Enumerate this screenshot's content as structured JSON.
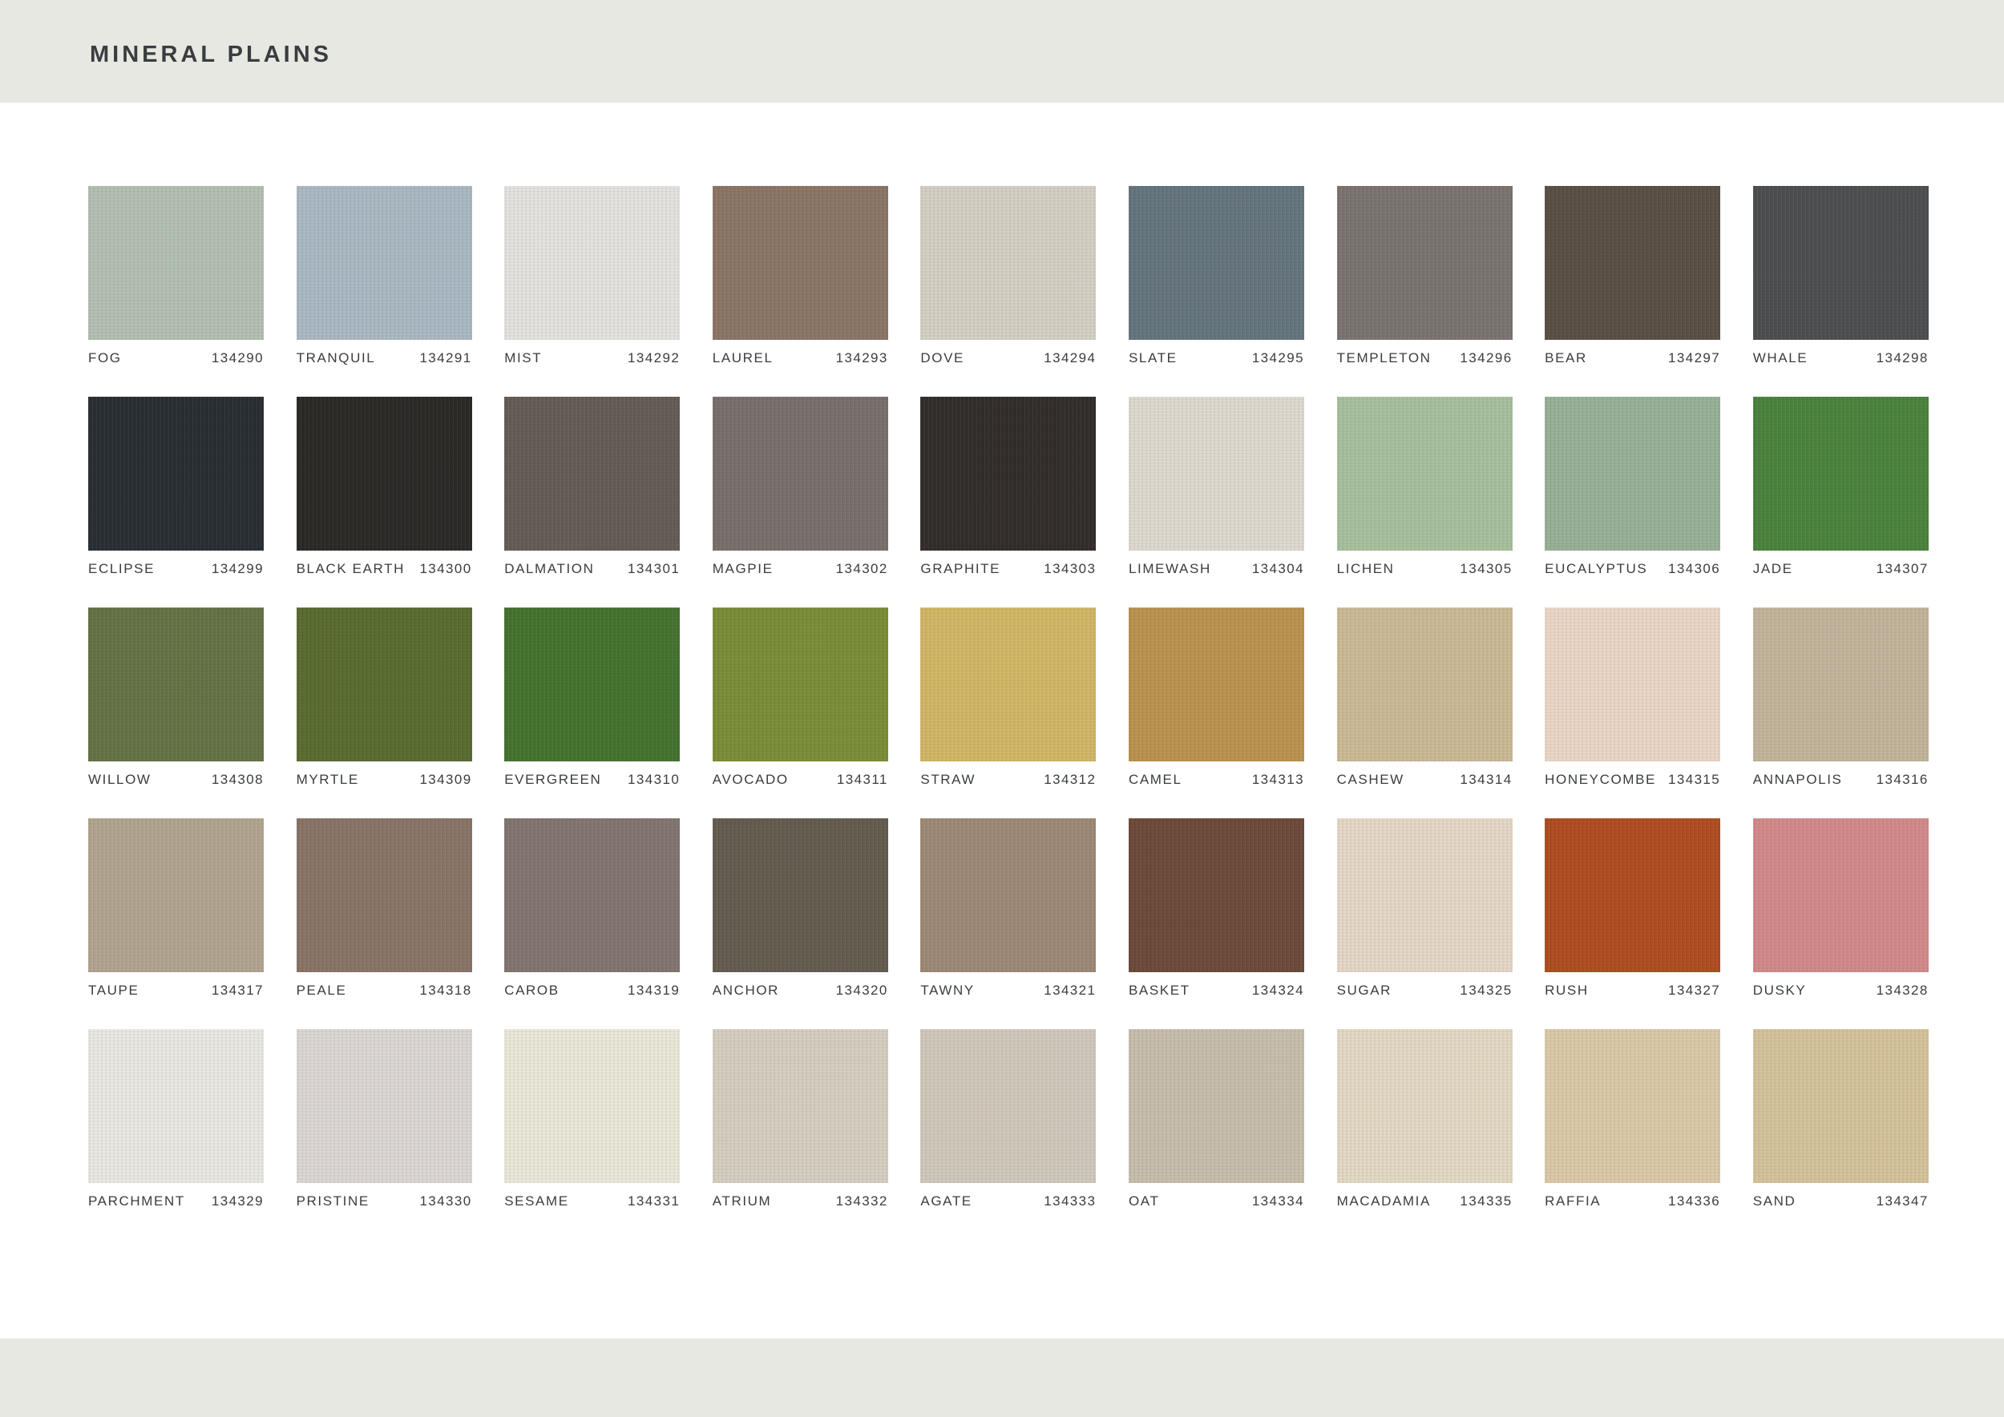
{
  "header": {
    "title": "MINERAL PLAINS"
  },
  "swatches": [
    {
      "name": "FOG",
      "code": "134290",
      "color": "#b4c1b4"
    },
    {
      "name": "TRANQUIL",
      "code": "134291",
      "color": "#abbac4"
    },
    {
      "name": "MIST",
      "code": "134292",
      "color": "#e6e4e1"
    },
    {
      "name": "LAUREL",
      "code": "134293",
      "color": "#8c7767"
    },
    {
      "name": "DOVE",
      "code": "134294",
      "color": "#d6d1c5"
    },
    {
      "name": "SLATE",
      "code": "134295",
      "color": "#66767f"
    },
    {
      "name": "TEMPLETON",
      "code": "134296",
      "color": "#7c7571"
    },
    {
      "name": "BEAR",
      "code": "134297",
      "color": "#5b5146"
    },
    {
      "name": "WHALE",
      "code": "134298",
      "color": "#4d4f51"
    },
    {
      "name": "ECLIPSE",
      "code": "134299",
      "color": "#2a2f35"
    },
    {
      "name": "BLACK EARTH",
      "code": "134300",
      "color": "#2c2a27"
    },
    {
      "name": "DALMATION",
      "code": "134301",
      "color": "#675d57"
    },
    {
      "name": "MAGPIE",
      "code": "134302",
      "color": "#7a706c"
    },
    {
      "name": "GRAPHITE",
      "code": "134303",
      "color": "#332e2b"
    },
    {
      "name": "LIMEWASH",
      "code": "134304",
      "color": "#e0dbd1"
    },
    {
      "name": "LICHEN",
      "code": "134305",
      "color": "#a9c19e"
    },
    {
      "name": "EUCALYPTUS",
      "code": "134306",
      "color": "#99b298"
    },
    {
      "name": "JADE",
      "code": "134307",
      "color": "#4b843e"
    },
    {
      "name": "WILLOW",
      "code": "134308",
      "color": "#657446"
    },
    {
      "name": "MYRTLE",
      "code": "134309",
      "color": "#5b6d31"
    },
    {
      "name": "EVERGREEN",
      "code": "134310",
      "color": "#46742f"
    },
    {
      "name": "AVOCADO",
      "code": "134311",
      "color": "#7c8e38"
    },
    {
      "name": "STRAW",
      "code": "134312",
      "color": "#d3b867"
    },
    {
      "name": "CAMEL",
      "code": "134313",
      "color": "#bc944f"
    },
    {
      "name": "CASHEW",
      "code": "134314",
      "color": "#cdbb96"
    },
    {
      "name": "HONEYCOMBE",
      "code": "134315",
      "color": "#ecd8c8"
    },
    {
      "name": "ANNAPOLIS",
      "code": "134316",
      "color": "#c4b69d"
    },
    {
      "name": "TAUPE",
      "code": "134317",
      "color": "#b3a690"
    },
    {
      "name": "PEALE",
      "code": "134318",
      "color": "#8a7568"
    },
    {
      "name": "CAROB",
      "code": "134319",
      "color": "#847670"
    },
    {
      "name": "ANCHOR",
      "code": "134320",
      "color": "#665d51"
    },
    {
      "name": "TAWNY",
      "code": "134321",
      "color": "#9e8a77"
    },
    {
      "name": "BASKET",
      "code": "134324",
      "color": "#6e4b3a"
    },
    {
      "name": "SUGAR",
      "code": "134325",
      "color": "#e6d9c8"
    },
    {
      "name": "RUSH",
      "code": "134327",
      "color": "#b04e22"
    },
    {
      "name": "DUSKY",
      "code": "134328",
      "color": "#d48b8b"
    },
    {
      "name": "PARCHMENT",
      "code": "134329",
      "color": "#eaeae3"
    },
    {
      "name": "PRISTINE",
      "code": "134330",
      "color": "#ddd8d5"
    },
    {
      "name": "SESAME",
      "code": "134331",
      "color": "#ebe9d9"
    },
    {
      "name": "ATRIUM",
      "code": "134332",
      "color": "#d7cfc1"
    },
    {
      "name": "AGATE",
      "code": "134333",
      "color": "#d2c9bd"
    },
    {
      "name": "OAT",
      "code": "134334",
      "color": "#c9bfae"
    },
    {
      "name": "MACADAMIA",
      "code": "134335",
      "color": "#e4dac5"
    },
    {
      "name": "RAFFIA",
      "code": "134336",
      "color": "#dccaa8"
    },
    {
      "name": "SAND",
      "code": "134347",
      "color": "#d6c49c"
    }
  ]
}
